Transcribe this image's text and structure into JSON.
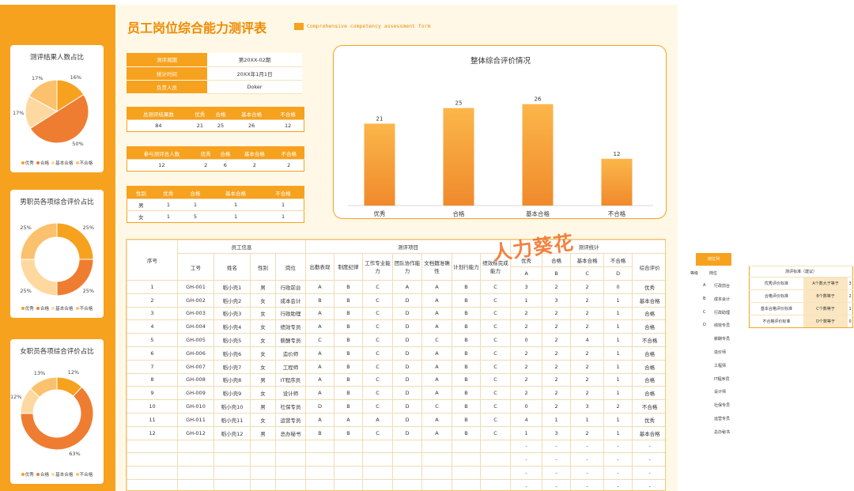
{
  "title": "员工岗位综合能力测评表",
  "subtitle_en": "Comprehensive competency assessment form",
  "watermark": "人力葵花",
  "colors": {
    "excellent": "#f6a21e",
    "qualified": "#ee7d31",
    "basic": "#fdd9a0",
    "fail": "#fbc16c"
  },
  "side_legend": [
    "优秀",
    "合格",
    "基本合格",
    "不合格"
  ],
  "side_charts": [
    {
      "title": "测评结果人数占比",
      "type": "pie",
      "values": [
        16,
        50,
        17,
        17
      ],
      "labels": [
        "16%",
        "50%",
        "17%",
        "17%"
      ]
    },
    {
      "title": "男职员各项综合评价占比",
      "type": "donut",
      "values": [
        25,
        25,
        25,
        25
      ],
      "labels": [
        "25%",
        "25%",
        "25%",
        "25%"
      ]
    },
    {
      "title": "女职员各项综合评价占比",
      "type": "donut",
      "values": [
        12,
        63,
        12,
        13
      ],
      "labels": [
        "12%",
        "63%",
        "12%",
        "13%"
      ]
    }
  ],
  "info": [
    {
      "key": "测评周期",
      "value": "第20XX-02期"
    },
    {
      "key": "统计时间",
      "value": "20XX年1月1日"
    },
    {
      "key": "负责人员",
      "value": "Doker"
    }
  ],
  "total_table": {
    "headers": [
      "总测评结果数",
      "优秀",
      "合格",
      "基本合格",
      "不合格"
    ],
    "rows": [
      [
        "84",
        "21",
        "25",
        "26",
        "12"
      ]
    ]
  },
  "people_table": {
    "headers": [
      "参与测评总人数",
      "优秀",
      "合格",
      "基本合格",
      "不合格"
    ],
    "rows": [
      [
        "12",
        "2",
        "6",
        "2",
        "2"
      ]
    ]
  },
  "gender_table": {
    "headers": [
      "性别",
      "优秀",
      "合格",
      "基本合格",
      "不合格"
    ],
    "rows": [
      [
        "男",
        "1",
        "1",
        "1",
        "1"
      ],
      [
        "女",
        "1",
        "5",
        "1",
        "1"
      ]
    ]
  },
  "chart_data": {
    "type": "bar",
    "title": "整体综合评价情况",
    "categories": [
      "优秀",
      "合格",
      "基本合格",
      "不合格"
    ],
    "values": [
      21,
      25,
      26,
      12
    ],
    "ylim": [
      0,
      30
    ]
  },
  "main_table": {
    "group_headers": {
      "seq": "序号",
      "info": "员工信息",
      "items": "测评项目",
      "stats": "测评统计"
    },
    "info_cols": [
      "工号",
      "姓名",
      "性别",
      "岗位"
    ],
    "item_cols": [
      "出勤表现",
      "制度纪律",
      "工作专业能力",
      "团队协作能力",
      "文档籍准确性",
      "计划行能力",
      "绩效标完成能力"
    ],
    "stat_cols": [
      "优秀",
      "合格",
      "基本合格",
      "不合格"
    ],
    "stat_codes": [
      "A",
      "B",
      "C",
      "D"
    ],
    "overall": "综合评价",
    "rows": [
      [
        "1",
        "GH-001",
        "稻小壳1",
        "男",
        "行政前台",
        "A",
        "B",
        "C",
        "A",
        "A",
        "B",
        "C",
        "3",
        "2",
        "2",
        "0",
        "优秀"
      ],
      [
        "2",
        "GH-002",
        "稻小壳2",
        "女",
        "成本会计",
        "B",
        "B",
        "C",
        "D",
        "A",
        "B",
        "C",
        "1",
        "3",
        "2",
        "1",
        "基本合格"
      ],
      [
        "3",
        "GH-003",
        "稻小壳3",
        "女",
        "行政助理",
        "A",
        "B",
        "C",
        "D",
        "A",
        "B",
        "C",
        "2",
        "2",
        "2",
        "1",
        "合格"
      ],
      [
        "4",
        "GH-004",
        "稻小壳4",
        "女",
        "绩效专员",
        "A",
        "B",
        "C",
        "D",
        "A",
        "B",
        "C",
        "2",
        "2",
        "2",
        "1",
        "合格"
      ],
      [
        "5",
        "GH-005",
        "稻小壳5",
        "女",
        "薪酬专员",
        "C",
        "B",
        "C",
        "D",
        "C",
        "B",
        "C",
        "0",
        "2",
        "4",
        "1",
        "不合格"
      ],
      [
        "6",
        "GH-006",
        "稻小壳6",
        "女",
        "造价师",
        "A",
        "B",
        "C",
        "D",
        "A",
        "B",
        "C",
        "2",
        "2",
        "2",
        "1",
        "合格"
      ],
      [
        "7",
        "GH-007",
        "稻小壳7",
        "女",
        "工程师",
        "A",
        "B",
        "C",
        "D",
        "A",
        "B",
        "C",
        "2",
        "2",
        "2",
        "1",
        "合格"
      ],
      [
        "8",
        "GH-008",
        "稻小壳8",
        "男",
        "IT程序员",
        "A",
        "B",
        "C",
        "D",
        "A",
        "B",
        "C",
        "2",
        "2",
        "2",
        "1",
        "合格"
      ],
      [
        "9",
        "GH-009",
        "稻小壳9",
        "女",
        "设计师",
        "A",
        "B",
        "C",
        "D",
        "A",
        "B",
        "C",
        "2",
        "2",
        "2",
        "1",
        "合格"
      ],
      [
        "10",
        "GH-010",
        "稻小壳10",
        "男",
        "社保专员",
        "D",
        "B",
        "C",
        "D",
        "C",
        "B",
        "C",
        "0",
        "2",
        "3",
        "2",
        "不合格"
      ],
      [
        "11",
        "GH-011",
        "稻小壳11",
        "女",
        "运营专员",
        "A",
        "A",
        "A",
        "D",
        "A",
        "B",
        "C",
        "4",
        "1",
        "1",
        "1",
        "优秀"
      ],
      [
        "12",
        "GH-012",
        "稻小壳12",
        "男",
        "总办秘书",
        "B",
        "B",
        "C",
        "D",
        "A",
        "B",
        "C",
        "1",
        "3",
        "2",
        "1",
        "基本合格"
      ]
    ],
    "empty_rows": 4,
    "empty_mark": "-"
  },
  "position_list": {
    "header": "岗位列",
    "grade_labels": [
      "等级",
      "岗位"
    ],
    "grades": [
      "A",
      "B",
      "C",
      "D"
    ],
    "items": [
      "行政前台",
      "成本会计",
      "行政助理",
      "绩效专员",
      "薪酬专员",
      "造价师",
      "工程师",
      "IT程序员",
      "设计师",
      "社保专员",
      "运营专员",
      "总办秘书"
    ]
  },
  "standards": {
    "title": "测评标准（建议）",
    "rows": [
      [
        "优秀评价标准",
        "A个数大于等于",
        "3"
      ],
      [
        "合格评价标准",
        "B个数等于",
        "2"
      ],
      [
        "基本合格评价标准",
        "C个数等于",
        "1"
      ],
      [
        "不合格评价标准",
        "D个数等于",
        "0"
      ]
    ]
  }
}
